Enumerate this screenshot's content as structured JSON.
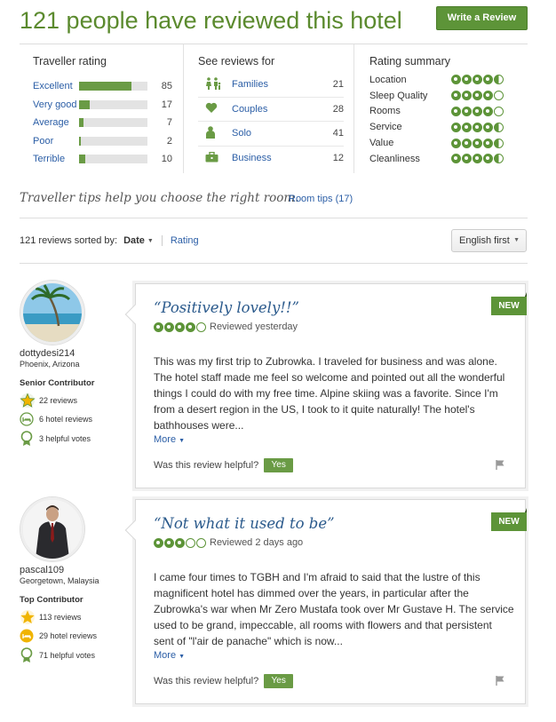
{
  "header": {
    "title": "121 people have reviewed this hotel",
    "write_review": "Write a Review"
  },
  "traveller_rating": {
    "title": "Traveller rating",
    "rows": [
      {
        "label": "Excellent",
        "count": "85",
        "fraction": 0.76
      },
      {
        "label": "Very good",
        "count": "17",
        "fraction": 0.15
      },
      {
        "label": "Average",
        "count": "7",
        "fraction": 0.06
      },
      {
        "label": "Poor",
        "count": "2",
        "fraction": 0.02
      },
      {
        "label": "Terrible",
        "count": "10",
        "fraction": 0.09
      }
    ]
  },
  "see_reviews": {
    "title": "See reviews for",
    "rows": [
      {
        "label": "Families",
        "count": "21",
        "icon": "family-icon"
      },
      {
        "label": "Couples",
        "count": "28",
        "icon": "heart-icon"
      },
      {
        "label": "Solo",
        "count": "41",
        "icon": "person-icon"
      },
      {
        "label": "Business",
        "count": "12",
        "icon": "briefcase-icon"
      }
    ]
  },
  "rating_summary": {
    "title": "Rating summary",
    "rows": [
      {
        "label": "Location",
        "rating": 4.5
      },
      {
        "label": "Sleep Quality",
        "rating": 4
      },
      {
        "label": "Rooms",
        "rating": 4
      },
      {
        "label": "Service",
        "rating": 4.5
      },
      {
        "label": "Value",
        "rating": 4.5
      },
      {
        "label": "Cleanliness",
        "rating": 4.5
      }
    ]
  },
  "tips": {
    "text": "Traveller tips help you choose the right room.",
    "link": "Room tips (17)"
  },
  "sort": {
    "prefix": "121 reviews sorted by:",
    "date": "Date",
    "rating": "Rating",
    "language": "English first"
  },
  "reviews": [
    {
      "reviewer": {
        "name": "dottydesi214",
        "location": "Phoenix, Arizona",
        "level": "Senior Contributor",
        "reviews": "22 reviews",
        "hotel_reviews": "6 hotel reviews",
        "helpful_votes": "3 helpful votes"
      },
      "badge": "NEW",
      "title": "“Positively lovely!!”",
      "rating": 4,
      "meta": "Reviewed yesterday",
      "body": "This was my first trip to Zubrowka. I traveled for business and was alone. The hotel staff made me feel so welcome and pointed out all the wonderful things I could do with my free time. Alpine skiing was a favorite. Since I'm from a desert region in the US, I took to it quite naturally! The hotel's bathhouses were...",
      "more": "More",
      "helpful_prompt": "Was this review helpful?",
      "yes": "Yes"
    },
    {
      "reviewer": {
        "name": "pascal109",
        "location": "Georgetown, Malaysia",
        "level": "Top Contributor",
        "reviews": "113 reviews",
        "hotel_reviews": "29 hotel reviews",
        "helpful_votes": "71 helpful votes"
      },
      "badge": "NEW",
      "title": "“Not what it used to be”",
      "rating": 3,
      "meta": "Reviewed 2 days ago",
      "body": "I came four times to TGBH and I'm afraid to said that the lustre of this magnificent hotel has dimmed over the years, in particular after the Zubrowka's war when Mr Zero Mustafa took over Mr Gustave H. The service used to be grand, impeccable, all rooms with flowers and that persistent sent of \"l'air de panache\" which is now...",
      "more": "More",
      "helpful_prompt": "Was this review helpful?",
      "yes": "Yes"
    }
  ]
}
